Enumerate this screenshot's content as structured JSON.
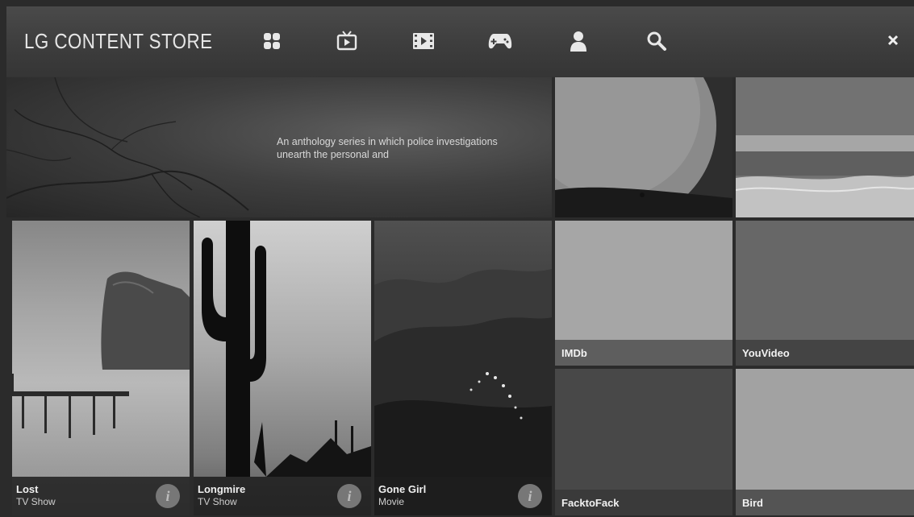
{
  "header": {
    "title": "LG CONTENT STORE",
    "nav": [
      {
        "icon": "grid-icon"
      },
      {
        "icon": "tv-icon"
      },
      {
        "icon": "film-icon"
      },
      {
        "icon": "gamepad-icon"
      },
      {
        "icon": "user-icon"
      },
      {
        "icon": "search-icon"
      }
    ],
    "close_icon": "close-icon"
  },
  "hero": {
    "description": "An anthology series in which police investigations unearth the personal and"
  },
  "posters": [
    {
      "title": "Lost",
      "type": "TV Show",
      "info_label": "i"
    },
    {
      "title": "Longmire",
      "type": "TV Show",
      "info_label": "i"
    },
    {
      "title": "Gone Girl",
      "type": "Movie",
      "info_label": "i"
    }
  ],
  "apps": [
    {
      "name": "IMDb"
    },
    {
      "name": "YouVideo"
    },
    {
      "name": "FacktoFack"
    },
    {
      "name": "Bird"
    }
  ]
}
